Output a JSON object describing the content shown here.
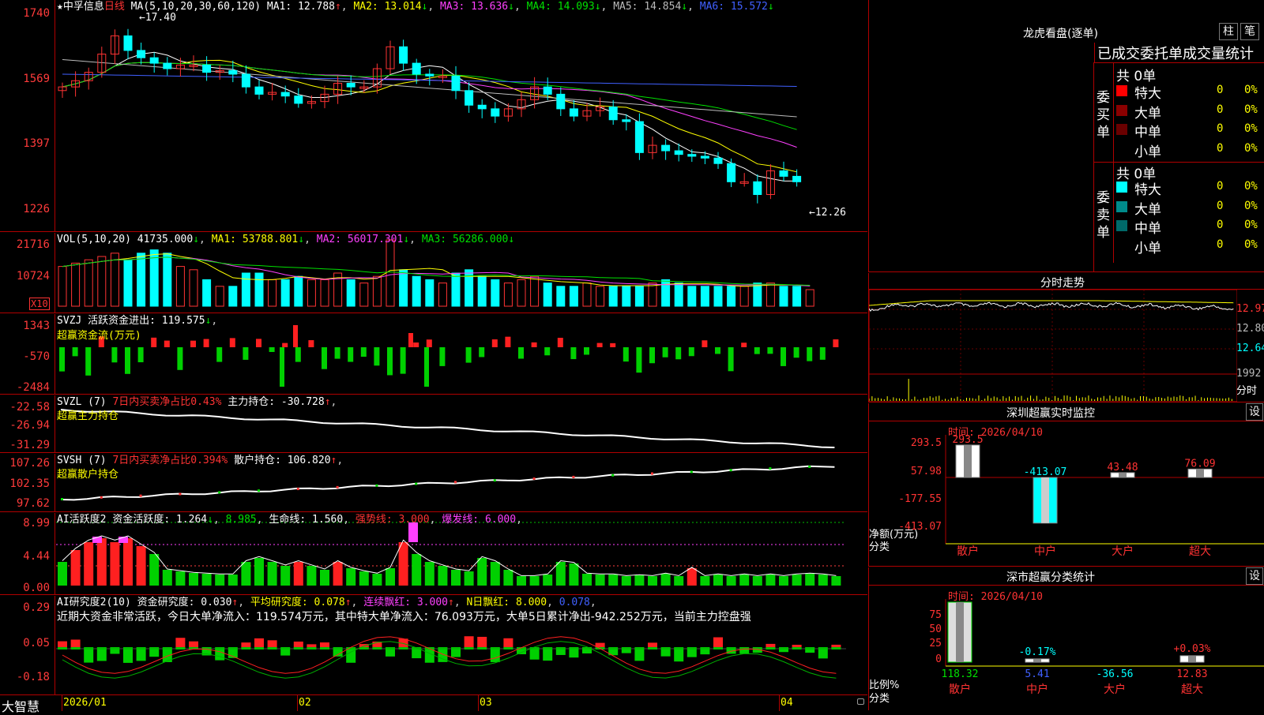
{
  "app": {
    "brand": "大智慧"
  },
  "kline": {
    "title": "★中孚信息",
    "period": "日线",
    "ma_label": "MA(5,10,20,30,60,120)",
    "ma": [
      {
        "label": "MA1: 12.788",
        "arrow": "↑",
        "color": "#ffffff"
      },
      {
        "label": "MA2: 13.014",
        "arrow": "↓",
        "color": "#ffff00"
      },
      {
        "label": "MA3: 13.636",
        "arrow": "↓",
        "color": "#ff40ff"
      },
      {
        "label": "MA4: 14.093",
        "arrow": "↓",
        "color": "#00e000"
      },
      {
        "label": "MA5: 14.854",
        "arrow": "↓",
        "color": "#bbbbbb"
      },
      {
        "label": "MA6: 15.572",
        "arrow": "↓",
        "color": "#4060ff"
      }
    ],
    "y_ticks": [
      "1740",
      "1569",
      "1397",
      "1226"
    ],
    "high_marker": "17.40",
    "low_marker": "12.26",
    "closes": [
      15.55,
      15.72,
      15.95,
      16.45,
      16.95,
      16.55,
      16.35,
      16.2,
      16.05,
      16.15,
      16.15,
      15.95,
      16.0,
      15.9,
      15.55,
      15.35,
      15.4,
      15.3,
      15.1,
      15.15,
      15.35,
      15.65,
      15.55,
      15.55,
      16.05,
      16.65,
      16.2,
      15.9,
      15.85,
      15.85,
      15.45,
      15.05,
      14.95,
      14.75,
      14.95,
      15.2,
      15.55,
      15.35,
      14.95,
      14.75,
      14.9,
      15.0,
      14.65,
      14.6,
      13.75,
      13.95,
      13.8,
      13.7,
      13.65,
      13.6,
      13.45,
      12.95,
      12.95,
      12.6,
      13.25,
      13.1,
      12.95
    ]
  },
  "vol": {
    "label": "VOL(5,10,20)",
    "value": "41735.000",
    "ma1": "MA1: 53788.801",
    "ma2": "MA2: 56017.301",
    "ma3": "MA3: 56286.000",
    "y_ticks": [
      "21716",
      "10724"
    ],
    "unit": "X10",
    "values": [
      12,
      13,
      14,
      15,
      16,
      14,
      16,
      17,
      16,
      12,
      11,
      8,
      6,
      6,
      10,
      10,
      8,
      8,
      9,
      8,
      8,
      10,
      8,
      7,
      9,
      20,
      11,
      9,
      8,
      7,
      10,
      11,
      9,
      8,
      7,
      8,
      9,
      7,
      6,
      6,
      7,
      6,
      6,
      6,
      6,
      7,
      8,
      7,
      6,
      6,
      6,
      6,
      6,
      7,
      7,
      6,
      6,
      5
    ]
  },
  "svzj": {
    "label": "SVZJ",
    "flow_label": "活跃资金进出: 119.575",
    "arrow": "↓",
    "subtitle": "超赢资金流(万元)",
    "y_ticks": [
      "1343",
      "-570",
      "-2484"
    ]
  },
  "svzl": {
    "label": "SVZL (7)",
    "ratio": "7日内买卖净占比0.43%",
    "hold": "主力持仓: -30.728",
    "arrow": "↑",
    "subtitle": "超赢主力持仓",
    "y_ticks": [
      "-22.58",
      "-26.94",
      "-31.29"
    ]
  },
  "svsh": {
    "label": "SVSH (7)",
    "ratio": "7日内买卖净占比0.394%",
    "hold": "散户持仓: 106.820",
    "arrow": "↑",
    "subtitle": "超赢散户持仓",
    "y_ticks": [
      "107.26",
      "102.35",
      "97.62"
    ]
  },
  "ai_active": {
    "label": "AI活跃度2",
    "active": "资金活跃度: 1.264",
    "arrow": "↓",
    "v2": "8.985",
    "life": "生命线: 1.560",
    "strong": "强势线: 3.000",
    "burst": "爆发线: 6.000",
    "y_ticks": [
      "8.99",
      "4.44",
      "0.00"
    ]
  },
  "ai_research": {
    "label": "AI研究度2(10)",
    "research": "资金研究度: 0.030",
    "avg": "平均研究度: 0.078",
    "red": "连续飘红: 3.000",
    "nred": "N日飘红: 8.000",
    "v5": "0.078",
    "y_ticks": [
      "0.29",
      "0.05",
      "-0.18"
    ],
    "commentary": "近期大资金非常活跃，今日大单净流入：119.574万元，其中特大单净流入：76.093万元，大单5日累计净出-942.252万元，当前主力控盘强"
  },
  "xaxis": {
    "labels": [
      "2026/01",
      "02",
      "03",
      "04"
    ]
  },
  "dragon": {
    "title": "龙虎看盘(逐单)",
    "btn_bar": "柱",
    "btn_pen": "笔",
    "tab_caption": "已成交委托单成交量统计",
    "buy": {
      "side": "委买单",
      "total": "共 0单",
      "rows": [
        {
          "name": "特大",
          "count": "0",
          "pct": "0%",
          "color": "#ff0000"
        },
        {
          "name": "大单",
          "count": "0",
          "pct": "0%",
          "color": "#8b0000"
        },
        {
          "name": "中单",
          "count": "0",
          "pct": "0%",
          "color": "#6a0000"
        },
        {
          "name": "小单",
          "count": "0",
          "pct": "0%",
          "color": "#000000"
        }
      ]
    },
    "sell": {
      "side": "委卖单",
      "total": "共 0单",
      "rows": [
        {
          "name": "特大",
          "count": "0",
          "pct": "0%",
          "color": "#00ffff"
        },
        {
          "name": "大单",
          "count": "0",
          "pct": "0%",
          "color": "#008b8b"
        },
        {
          "name": "中单",
          "count": "0",
          "pct": "0%",
          "color": "#006a6a"
        },
        {
          "name": "小单",
          "count": "0",
          "pct": "0%",
          "color": "#000000"
        }
      ]
    }
  },
  "minute": {
    "title": "分时走势",
    "prices": [
      "12.97",
      "12.80",
      "12.64"
    ],
    "vol": "1992",
    "unit": "分时"
  },
  "sz_monitor": {
    "title": "深圳超赢实时监控",
    "btn": "设",
    "time": "时间: 2026/04/10",
    "y_ticks": [
      "293.5",
      "57.98",
      "0",
      "-177.55",
      "-413.07"
    ],
    "y_unit": "净额(万元)",
    "cat_label": "分类",
    "bars": [
      {
        "cat": "散户",
        "value": 293.5,
        "label": "293.5"
      },
      {
        "cat": "中户",
        "value": -413.07,
        "label": "-413.07"
      },
      {
        "cat": "大户",
        "value": 43.48,
        "label": "43.48"
      },
      {
        "cat": "超大",
        "value": 76.09,
        "label": "76.09"
      }
    ]
  },
  "sz_class": {
    "title": "深市超赢分类统计",
    "btn": "设",
    "time": "时间: 2026/04/10",
    "y_ticks": [
      "75",
      "50",
      "25",
      "0"
    ],
    "y_unit": "比例%",
    "cat_label": "分类",
    "bars": [
      {
        "cat": "散户",
        "value": 118.32,
        "label": "118.32",
        "top": ""
      },
      {
        "cat": "中户",
        "value": 5.41,
        "label": "5.41",
        "top": "-0.17%"
      },
      {
        "cat": "大户",
        "value": -36.56,
        "label": "-36.56",
        "top": ""
      },
      {
        "cat": "超大",
        "value": 12.83,
        "label": "12.83",
        "top": "+0.03%"
      }
    ]
  }
}
